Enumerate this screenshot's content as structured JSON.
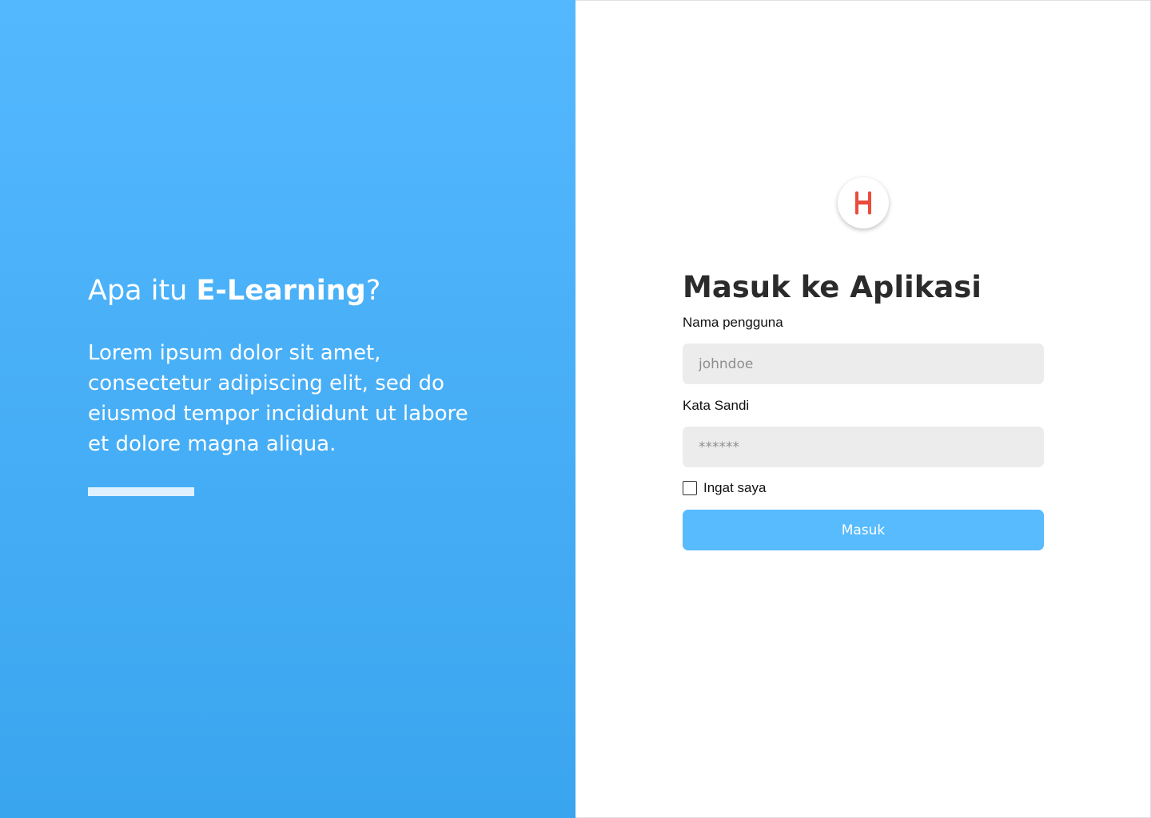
{
  "hero": {
    "heading_prefix": "Apa itu ",
    "heading_bold": "E-Learning",
    "heading_suffix": "?",
    "description": "Lorem ipsum dolor sit amet, consectetur adipiscing elit, sed do eiusmod tempor incididunt ut labore et dolore magna aliqua."
  },
  "logo": {
    "icon": "h-logo-icon",
    "color": "#ea4c3c"
  },
  "login": {
    "title": "Masuk ke Aplikasi",
    "username_label": "Nama pengguna",
    "username_placeholder": "johndoe",
    "password_label": "Kata Sandi",
    "password_placeholder": "******",
    "remember_label": "Ingat saya",
    "remember_checked": false,
    "submit_label": "Masuk"
  },
  "colors": {
    "gradient_top": "#54b8fe",
    "gradient_bottom": "#3aa5ef",
    "button": "#58bbfd",
    "input_bg": "#ececec"
  }
}
